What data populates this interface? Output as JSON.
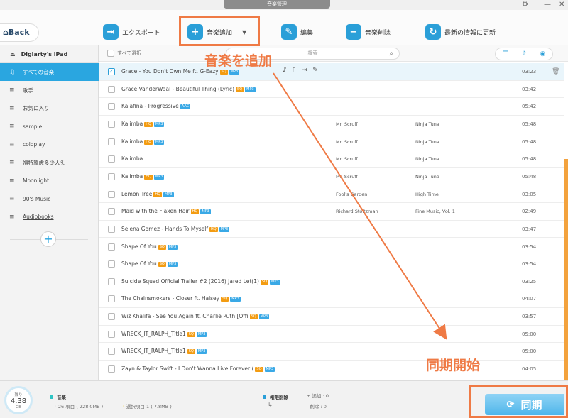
{
  "window": {
    "title": "音楽管理"
  },
  "toolbar": {
    "back_label": "Back",
    "buttons": [
      {
        "label": "エクスポート",
        "icon": "export-icon"
      },
      {
        "label": "音楽追加",
        "icon": "add-music-icon"
      },
      {
        "label": "編集",
        "icon": "edit-icon"
      },
      {
        "label": "音楽削除",
        "icon": "delete-music-icon"
      },
      {
        "label": "最新の情報に更新",
        "icon": "refresh-icon"
      }
    ]
  },
  "sidebar": {
    "device": "Digiarty's iPad",
    "items": [
      {
        "label": "すべての音楽",
        "active": true
      },
      {
        "label": "歌手"
      },
      {
        "label": "お気に入り"
      },
      {
        "label": "sample"
      },
      {
        "label": "coldplay"
      },
      {
        "label": "福特翼虎多少人头"
      },
      {
        "label": "Moonlight"
      },
      {
        "label": "90's Music"
      },
      {
        "label": "Audiobooks"
      }
    ]
  },
  "list": {
    "select_all": "すべて選択",
    "search_placeholder": "検索",
    "rows": [
      {
        "title": "Grace - You Don't Own Me ft. G-Eazy",
        "badges": [
          "SQ",
          "MP3"
        ],
        "artist": "",
        "album": "",
        "duration": "03:23",
        "selected": true
      },
      {
        "title": "Grace VanderWaal - Beautiful Thing (Lyric)",
        "badges": [
          "SQ",
          "MP3"
        ],
        "artist": "",
        "album": "",
        "duration": "03:42"
      },
      {
        "title": "Kalafina - Progressive",
        "badges": [
          "AAC"
        ],
        "artist": "",
        "album": "",
        "duration": "05:42"
      },
      {
        "title": "Kalimba",
        "badges": [
          "HQ",
          "MP3"
        ],
        "artist": "Mr. Scruff",
        "album": "Ninja Tuna",
        "duration": "05:48"
      },
      {
        "title": "Kalimba",
        "badges": [
          "HQ",
          "MP3"
        ],
        "artist": "Mr. Scruff",
        "album": "Ninja Tuna",
        "duration": "05:48"
      },
      {
        "title": "Kalimba",
        "badges": [],
        "artist": "Mr. Scruff",
        "album": "Ninja Tuna",
        "duration": "05:48"
      },
      {
        "title": "Kalimba",
        "badges": [
          "HQ",
          "MP3"
        ],
        "artist": "Mr. Scruff",
        "album": "Ninja Tuna",
        "duration": "05:48"
      },
      {
        "title": "Lemon Tree",
        "badges": [
          "HQ",
          "MP3"
        ],
        "artist": "Fool's Garden",
        "album": "High Time",
        "duration": "03:05"
      },
      {
        "title": "Maid with the Flaxen Hair",
        "badges": [
          "HQ",
          "MP3"
        ],
        "artist": "Richard Stoltzman",
        "album": "Fine Music, Vol. 1",
        "duration": "02:49"
      },
      {
        "title": "Selena Gomez - Hands To Myself",
        "badges": [
          "HQ",
          "MP3"
        ],
        "artist": "",
        "album": "",
        "duration": "03:47"
      },
      {
        "title": "Shape Of You",
        "badges": [
          "SQ",
          "MP3"
        ],
        "artist": "",
        "album": "",
        "duration": "03:54"
      },
      {
        "title": "Shape Of You",
        "badges": [
          "SQ",
          "MP3"
        ],
        "artist": "",
        "album": "",
        "duration": "03:54"
      },
      {
        "title": "Suicide Squad Official Trailer #2 (2016) Jared Let(1)",
        "badges": [
          "SQ",
          "MP3"
        ],
        "artist": "",
        "album": "",
        "duration": "03:25"
      },
      {
        "title": "The Chainsmokers - Closer ft. Halsey",
        "badges": [
          "SQ",
          "MP3"
        ],
        "artist": "",
        "album": "",
        "duration": "04:07"
      },
      {
        "title": "Wiz Khalifa - See You Again ft. Charlie Puth [Offi",
        "badges": [
          "SQ",
          "MP3"
        ],
        "artist": "",
        "album": "",
        "duration": "03:57"
      },
      {
        "title": "WRECK_IT_RALPH_Title1",
        "badges": [
          "SQ",
          "MP3"
        ],
        "artist": "",
        "album": "",
        "duration": "05:00"
      },
      {
        "title": "WRECK_IT_RALPH_Title1",
        "badges": [
          "SQ",
          "MP3"
        ],
        "artist": "",
        "album": "",
        "duration": "05:00"
      },
      {
        "title": "Zayn & Taylor Swift - I Don't Wanna Live Forever (",
        "badges": [
          "SQ",
          "MP3"
        ],
        "artist": "",
        "album": "",
        "duration": "04:05"
      }
    ]
  },
  "footer": {
    "capacity_label": "残り",
    "capacity_value": "4.38",
    "capacity_unit": "GB",
    "music_label": "音楽",
    "items_text": "26 項目 ( 228.0MB )",
    "selected_text": "選択項目 1 ( 7.8MB )",
    "perm_delete": "権限削除",
    "added": "+ 追加 : 0",
    "removed": "- 削除 : 0",
    "sync_label": "同期"
  },
  "annotations": {
    "add_music": "音楽を追加",
    "start_sync": "同期開始",
    "color": "#ef7a45"
  }
}
